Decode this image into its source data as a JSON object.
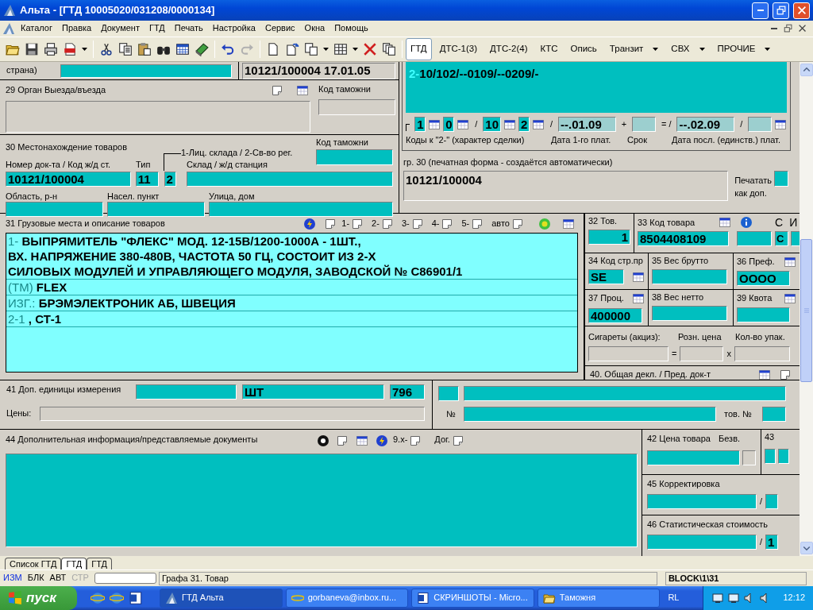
{
  "window": {
    "title": "Альта - [ГТД 10005020/031208/0000134]"
  },
  "menu": [
    "Каталог",
    "Правка",
    "Документ",
    "ГТД",
    "Печать",
    "Настройка",
    "Сервис",
    "Окна",
    "Помощь"
  ],
  "doc_tabs": [
    {
      "label": "ГТД",
      "selected": true,
      "dropdown": false
    },
    {
      "label": "ДТС-1(3)",
      "selected": false,
      "dropdown": false
    },
    {
      "label": "ДТС-2(4)",
      "selected": false,
      "dropdown": false
    },
    {
      "label": "КТС",
      "selected": false,
      "dropdown": false
    },
    {
      "label": "Опись",
      "selected": false,
      "dropdown": false
    },
    {
      "label": "Транзит",
      "selected": false,
      "dropdown": true
    },
    {
      "label": "СВХ",
      "selected": false,
      "dropdown": true
    },
    {
      "label": "ПРОЧИЕ",
      "selected": false,
      "dropdown": true
    }
  ],
  "country": {
    "label": "страна)"
  },
  "reference": {
    "value": "10121/100004 17.01.05"
  },
  "box29": {
    "label": "29 Орган Выезда/въезда",
    "customs_label": "Код таможни"
  },
  "box30": {
    "label": "30 Местонахождение товаров",
    "hint": "1-Лиц. склада / 2-Св-во рег.",
    "customs_label": "Код таможни",
    "doc_label": "Номер док-та / Код ж/д ст.",
    "doc_value": "10121/100004",
    "type_label": "Тип",
    "type_value": "11",
    "kind_value": "2",
    "warehouse_label": "Склад / ж/д станция",
    "region_label": "Область, р-н",
    "town_label": "Насел. пункт",
    "street_label": "Улица, дом"
  },
  "deal_codes": {
    "lines": [
      {
        "prefix": "2-",
        "text": "10/102/--0109/--0209/-"
      }
    ],
    "row": [
      {
        "kind": "code",
        "value": "1",
        "picker": true
      },
      {
        "kind": "code",
        "value": "0",
        "picker": true
      },
      {
        "kind": "sep",
        "text": "/"
      },
      {
        "kind": "code",
        "value": "10",
        "picker": true
      },
      {
        "kind": "code",
        "value": "2",
        "picker": true
      },
      {
        "kind": "sep",
        "text": "/"
      },
      {
        "kind": "date",
        "value": "--.01.09",
        "picker": false
      },
      {
        "kind": "sep",
        "text": "+"
      },
      {
        "kind": "term",
        "picker": false
      },
      {
        "kind": "sep",
        "text": "= /"
      },
      {
        "kind": "date",
        "value": "--.02.09",
        "picker": false
      },
      {
        "kind": "sep",
        "text": "/"
      },
      {
        "kind": "term",
        "picker": true
      }
    ],
    "labels": [
      "Коды к \"2-\" (характер сделки)",
      "Дата 1-го плат.",
      "Срок",
      "Дата посл. (единств.) плат."
    ]
  },
  "print_form": {
    "label": "гр. 30 (печатная форма - создаётся автоматически)",
    "value": "10121/100004",
    "print_label": "Печатать как доп.",
    "checked": false
  },
  "box31": {
    "label": "31 Грузовые места и описание товаров",
    "tools": [
      "1-",
      "2-",
      "3-",
      "4-",
      "5-",
      "авто"
    ],
    "rows": [
      {
        "prefix": "1-",
        "lines": [
          "ВЫПРЯМИТЕЛЬ \"ФЛЕКС\" МОД. 12-15В/1200-1000А - 1ШТ.,",
          "ВХ. НАПРЯЖЕНИЕ 380-480В, ЧАСТОТА  50 ГЦ, СОСТОИТ ИЗ 2-Х",
          "СИЛОВЫХ МОДУЛЕЙ И УПРАВЛЯЮЩЕГО МОДУЛЯ, ЗАВОДСКОЙ № С86901/1"
        ]
      },
      {
        "prefix": "(ТМ)",
        "lines": [
          "FLEX"
        ]
      },
      {
        "prefix": "ИЗГ.:",
        "lines": [
          "БРЭМЭЛЕКТРОНИК АБ, ШВЕЦИЯ"
        ]
      },
      {
        "prefix": "2-1",
        "lines": [
          ", СТ-1"
        ]
      }
    ]
  },
  "box32": {
    "label": "32 Тов.",
    "value": "1"
  },
  "box33": {
    "label": "33 Код товара",
    "value": "8504408109",
    "c_label": "С",
    "i_label": "И",
    "c_value": "С"
  },
  "box34": {
    "label": "34 Код стр.пр",
    "value": "SE"
  },
  "box35": {
    "label": "35 Вес брутто"
  },
  "box36": {
    "label": "36 Преф.",
    "value": "ОООО"
  },
  "box37": {
    "label": "37 Проц.",
    "value": "400000"
  },
  "box38": {
    "label": "38 Вес нетто"
  },
  "box39": {
    "label": "39 Квота"
  },
  "cigarettes": {
    "label": "Сигареты (акциз):",
    "price_label": "Розн. цена",
    "qty_label": "Кол-во упак.",
    "eq": "=",
    "times": "x"
  },
  "box41": {
    "label": "41 Доп. единицы измерения",
    "unit": "ШТ",
    "code": "796",
    "prices_label": "Цены:"
  },
  "box40": {
    "label": "40. Общая декл. / Пред. док-т",
    "no_label": "№",
    "item_label": "тов. №"
  },
  "box44": {
    "label": "44 Дополнительная информация/представляемые документы",
    "tools": [
      "9.х-",
      "Дог."
    ]
  },
  "box42": {
    "label": "42 Цена товара",
    "free_label": "Безв."
  },
  "box43": {
    "label": "43"
  },
  "box45": {
    "label": "45 Корректировка",
    "sep": "/"
  },
  "box46": {
    "label": "46 Статистическая стоимость",
    "sep": "/",
    "method": "1"
  },
  "sheet_tabs": [
    {
      "label": "Список ГТД",
      "selected": false
    },
    {
      "label": "ГТД",
      "selected": true
    },
    {
      "label": "ГТД",
      "selected": false
    }
  ],
  "status": {
    "modes": [
      {
        "label": "ИЗМ",
        "highlighted": true,
        "disabled": false
      },
      {
        "label": "БЛК",
        "highlighted": false,
        "disabled": false
      },
      {
        "label": "АВТ",
        "highlighted": false,
        "disabled": false
      },
      {
        "label": "СТР",
        "highlighted": false,
        "disabled": true
      }
    ],
    "message": "Графа 31. Товар",
    "block": "BLOCK\\1\\31"
  },
  "taskbar": {
    "start": "пуск",
    "tasks": [
      {
        "label": "ГТД Альта",
        "kind": "app",
        "active": true
      },
      {
        "label": "gorbaneva@inbox.ru...",
        "kind": "browser",
        "active": false
      },
      {
        "label": "СКРИНШОТЫ - Micro...",
        "kind": "document",
        "active": false
      },
      {
        "label": "Таможня",
        "kind": "folder",
        "active": false
      }
    ],
    "language": "RL",
    "clock": "12:12"
  }
}
